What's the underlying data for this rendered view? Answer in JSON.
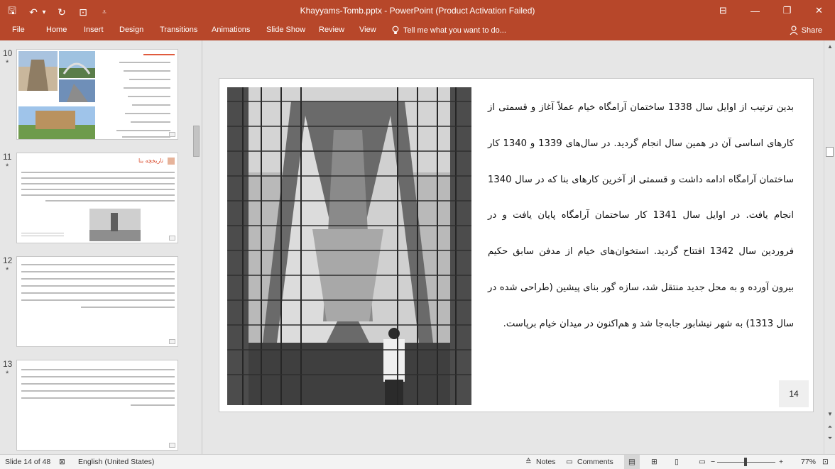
{
  "window": {
    "title": "Khayyams-Tomb.pptx - PowerPoint (Product Activation Failed)",
    "qat_icons": [
      "save-icon",
      "undo-icon",
      "undo-dropdown-icon",
      "redo-icon",
      "start-from-beginning-icon",
      "customize-qat-icon"
    ],
    "qat_glyphs": [
      "🖫",
      "↶",
      "▾",
      "↻",
      "⊡",
      "⩡"
    ],
    "controls": [
      "⊟",
      "—",
      "❐",
      "✕"
    ]
  },
  "ribbon": {
    "tabs": [
      "File",
      "Home",
      "Insert",
      "Design",
      "Transitions",
      "Animations",
      "Slide Show",
      "Review",
      "View"
    ],
    "tell_me": "Tell me what you want to do...",
    "share": "Share"
  },
  "thumbnails": {
    "items": [
      {
        "number": "10",
        "star": "*"
      },
      {
        "number": "11",
        "star": "*",
        "title": "تاریخچه بنا"
      },
      {
        "number": "12",
        "star": "*"
      },
      {
        "number": "13",
        "star": "*"
      }
    ]
  },
  "slide": {
    "text": "بدین ترتیب از اوایل سال 1338 ساختمان آرامگاه خیام عملاً آغاز و قسمتی از کارهای اساسی آن در همین سال انجام گردید. در سال‌های 1339 و 1340 کار ساختمان آرامگاه ادامه داشت و قسمتی از آخرین کارهای بنا که در سال 1340 انجام یافت. در اوایل سال 1341 کار ساختمان آرامگاه پایان یافت و در فروردین سال 1342 افتتاح گردید. استخوان‌های خیام از مدفن سابق حکیم بیرون آورده و به محل جدید منتقل شد، سازه گور بنای پیشین (طراحی شده در سال 1313) به شهر نیشابور جابه‌جا شد و هم‌اکنون در میدان خیام برپاست.",
    "number": "14"
  },
  "status": {
    "slide_info": "Slide 14 of 48",
    "language": "English (United States)",
    "notes": "Notes",
    "comments": "Comments",
    "zoom": "77%",
    "minus": "−",
    "plus": "+"
  }
}
